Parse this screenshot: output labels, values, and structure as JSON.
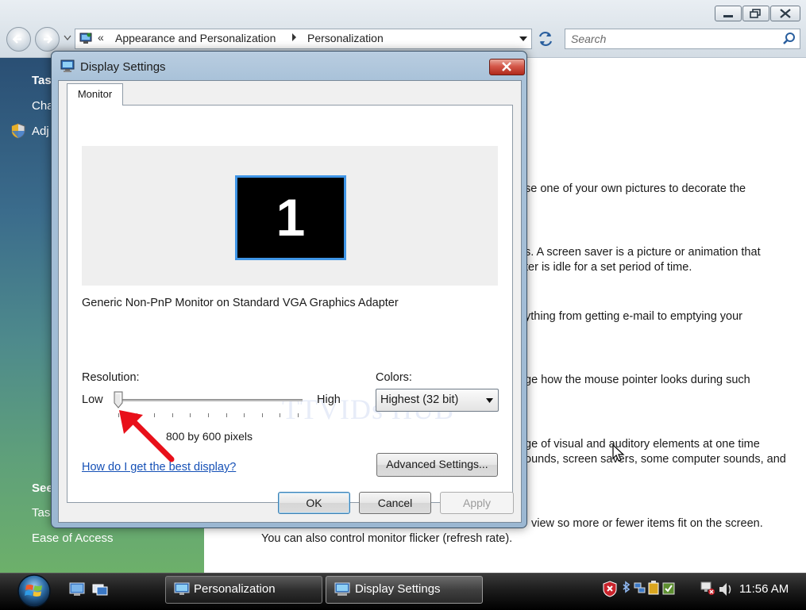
{
  "explorer": {
    "breadcrumb_prefix": "«",
    "breadcrumb": [
      "Appearance and Personalization",
      "Personalization"
    ],
    "search_placeholder": "Search"
  },
  "sidebar": {
    "tasks_heading": "Tas",
    "change_item": "Cha",
    "adjust_item": "Adj",
    "see_also_heading": "See",
    "taskbar_item": "Tas",
    "ease_item": "Ease of Access"
  },
  "content_lines": [
    "se one of your own pictures to decorate the",
    "s. A screen saver is a picture or animation that",
    "ter is idle for a set period of time.",
    "ything from getting e-mail to emptying your",
    "ge how the mouse pointer looks during such",
    "ge of visual and auditory elements at one time",
    "ounds, screen savers, some computer sounds, and",
    "view so more or fewer items fit on the screen.",
    "You can also control monitor flicker (refresh rate)."
  ],
  "dialog": {
    "title": "Display Settings",
    "tab": "Monitor",
    "monitor_number": "1",
    "adapter": "Generic Non-PnP Monitor on Standard VGA Graphics Adapter",
    "resolution_label": "Resolution:",
    "low_label": "Low",
    "high_label": "High",
    "resolution_value": "800 by 600 pixels",
    "resolution_slider_fraction": 0.0,
    "colors_label": "Colors:",
    "colors_value": "Highest (32 bit)",
    "help_link": "How do I get the best display?",
    "advanced_button": "Advanced Settings...",
    "ok_button": "OK",
    "cancel_button": "Cancel",
    "apply_button": "Apply"
  },
  "watermark": "TTVIDs HUB",
  "taskbar": {
    "tasks": [
      "Personalization",
      "Display Settings"
    ],
    "clock": "11:56 AM"
  },
  "colors": {
    "accent_blue": "#3f95e6",
    "link": "#1550b6",
    "arrow_red": "#e8101a",
    "close_red": "#d4584a"
  }
}
